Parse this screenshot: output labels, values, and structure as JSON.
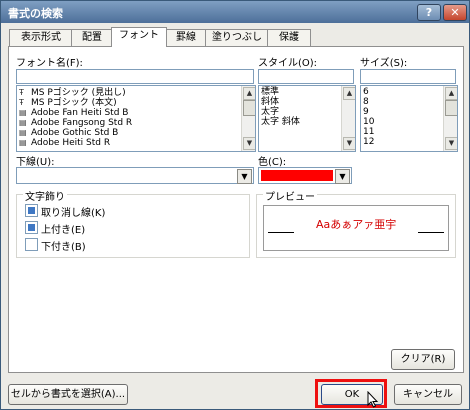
{
  "window": {
    "title": "書式の検索",
    "help": "?",
    "close": "✕"
  },
  "tabs": [
    "表示形式",
    "配置",
    "フォント",
    "罫線",
    "塗りつぶし",
    "保護"
  ],
  "active_tab": 2,
  "font_name": {
    "label": "フォント名(F):",
    "value": "",
    "items": [
      "MS Pゴシック (見出し)",
      "MS Pゴシック (本文)",
      "Adobe Fan Heiti Std B",
      "Adobe Fangsong Std R",
      "Adobe Gothic Std B",
      "Adobe Heiti Std R"
    ],
    "item_icons": [
      "font-type-icon",
      "font-type-icon",
      "font-type-icon",
      "font-type-icon",
      "font-type-icon",
      "font-type-icon"
    ]
  },
  "style": {
    "label": "スタイル(O):",
    "value": "",
    "items": [
      "標準",
      "斜体",
      "太字",
      "太字 斜体"
    ]
  },
  "size": {
    "label": "サイズ(S):",
    "value": "",
    "items": [
      "6",
      "8",
      "9",
      "10",
      "11",
      "12"
    ]
  },
  "underline": {
    "label": "下線(U):",
    "value": ""
  },
  "color": {
    "label": "色(C):",
    "value": "#ff0000"
  },
  "effects": {
    "label": "文字飾り",
    "items": [
      {
        "label": "取り消し線(K)",
        "checked": true
      },
      {
        "label": "上付き(E)",
        "checked": true
      },
      {
        "label": "下付き(B)",
        "checked": false
      }
    ]
  },
  "preview": {
    "label": "プレビュー",
    "text": "Aaあぁアァ亜宇",
    "color": "#d40000"
  },
  "buttons": {
    "clear": "クリア(R)",
    "from_cell": "セルから書式を選択(A)...",
    "ok": "OK",
    "cancel": "キャンセル"
  },
  "accent_color": "#ee1010"
}
